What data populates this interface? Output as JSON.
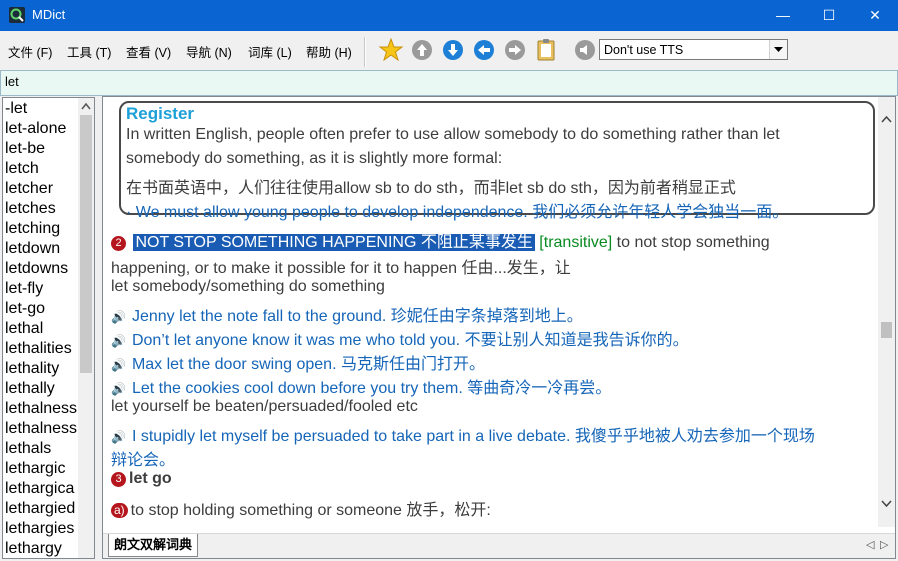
{
  "window": {
    "title": "MDict",
    "minimize": "—",
    "maximize": "☐",
    "close": "✕"
  },
  "menu": [
    "文件 (F)",
    "工具 (T)",
    "查看 (V)",
    "导航 (N)",
    "词库 (L)",
    "帮助 (H)"
  ],
  "toolbar": {
    "tts_label": "Don't use TTS"
  },
  "search": {
    "value": "let"
  },
  "wordlist": [
    "-let",
    "let-alone",
    "let-be",
    "letch",
    "letcher",
    "letches",
    "letching",
    "letdown",
    "letdowns",
    "let-fly",
    "let-go",
    "lethal",
    "lethalities",
    "lethality",
    "lethally",
    "lethalness",
    "lethalness",
    "lethals",
    "lethargic",
    "lethargica",
    "lethargied",
    "lethargies",
    "lethargy"
  ],
  "register": {
    "heading": "Register",
    "line1": "In written English, people often prefer to use allow somebody to do something rather than let",
    "line2": "somebody do something, as it is slightly more formal:",
    "line3": "在书面英语中，人们往往使用allow sb to do sth，而非let sb do sth，因为前者稍显正式",
    "example": "· We must allow young people to develop independence. 我们必须允许年轻人学会独当一面。"
  },
  "sense2": {
    "number": "2",
    "headword": "NOT STOP SOMETHING HAPPENING 不阻止某事发生",
    "grammar": "[transitive]",
    "def1": "to not stop something",
    "def2": "happening, or to make it possible for it to happen 任由...发生，让",
    "pattern": "let somebody/something do something",
    "ex1": "Jenny let the note fall to the ground. 珍妮任由字条掉落到地上。",
    "ex2": "Don’t let anyone know it was me who told you. 不要让别人知道是我告诉你的。",
    "ex3": "Max let the door swing open. 马克斯任由门打开。",
    "ex4": "Let the cookies cool down before you try them. 等曲奇冷一冷再尝。",
    "pattern2": "let yourself be beaten/persuaded/fooled etc",
    "ex5a": "I stupidly let myself be persuaded to take part in a live debate. 我傻乎乎地被人劝去参加一个现场",
    "ex5b": "辩论会。"
  },
  "sense3": {
    "number": "3",
    "headword": "let go",
    "sub": "a)",
    "def": "to stop holding something or someone 放手，松开:"
  },
  "tabs": {
    "active": "朗文双解词典"
  }
}
